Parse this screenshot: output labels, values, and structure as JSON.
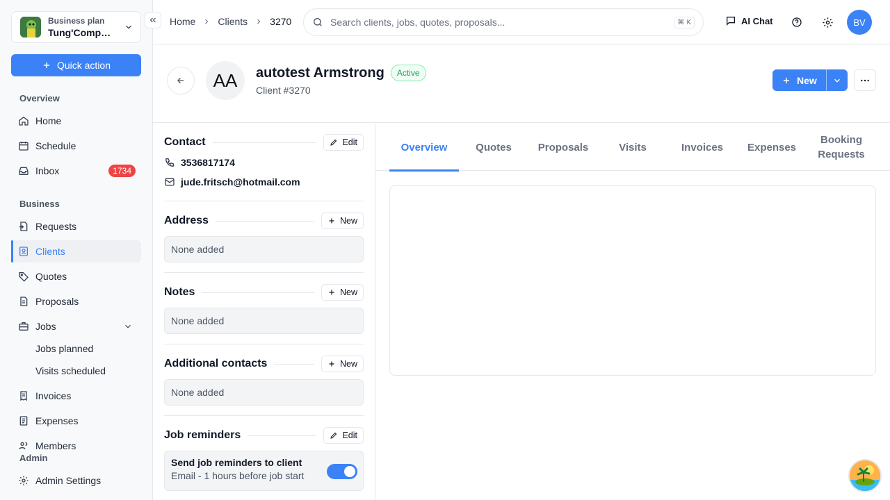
{
  "workspace": {
    "plan": "Business plan",
    "name": "Tung'Company"
  },
  "quick_action": "Quick action",
  "sidebar": {
    "overview_label": "Overview",
    "business_label": "Business",
    "admin_label": "Admin",
    "items": {
      "home": "Home",
      "schedule": "Schedule",
      "inbox": "Inbox",
      "inbox_badge": "1734",
      "requests": "Requests",
      "clients": "Clients",
      "quotes": "Quotes",
      "proposals": "Proposals",
      "jobs": "Jobs",
      "jobs_planned": "Jobs planned",
      "visits_scheduled": "Visits scheduled",
      "invoices": "Invoices",
      "expenses": "Expenses",
      "members": "Members",
      "admin_settings": "Admin Settings"
    }
  },
  "breadcrumb": [
    "Home",
    "Clients",
    "3270"
  ],
  "search": {
    "placeholder": "Search clients, jobs, quotes, proposals...",
    "shortcut": "⌘ K"
  },
  "topbar": {
    "ai_chat": "AI Chat",
    "avatar": "BV"
  },
  "client": {
    "initials": "AA",
    "name": "autotest Armstrong",
    "status": "Active",
    "number": "Client #3270"
  },
  "actions": {
    "new": "New"
  },
  "contact": {
    "title": "Contact",
    "edit": "Edit",
    "phone": "3536817174",
    "email": "jude.fritsch@hotmail.com"
  },
  "address": {
    "title": "Address",
    "new": "New",
    "empty": "None added"
  },
  "notes": {
    "title": "Notes",
    "new": "New",
    "empty": "None added"
  },
  "additional_contacts": {
    "title": "Additional contacts",
    "new": "New",
    "empty": "None added"
  },
  "job_reminders": {
    "title": "Job reminders",
    "edit": "Edit",
    "label": "Send job reminders to client",
    "detail": "Email - 1 hours before job start",
    "enabled": true
  },
  "tabs": [
    "Overview",
    "Quotes",
    "Proposals",
    "Visits",
    "Invoices",
    "Expenses",
    "Booking Requests"
  ],
  "active_tab": "Overview",
  "colors": {
    "accent": "#3b82f6",
    "badge": "#ef4444",
    "status": "#16a34a"
  }
}
